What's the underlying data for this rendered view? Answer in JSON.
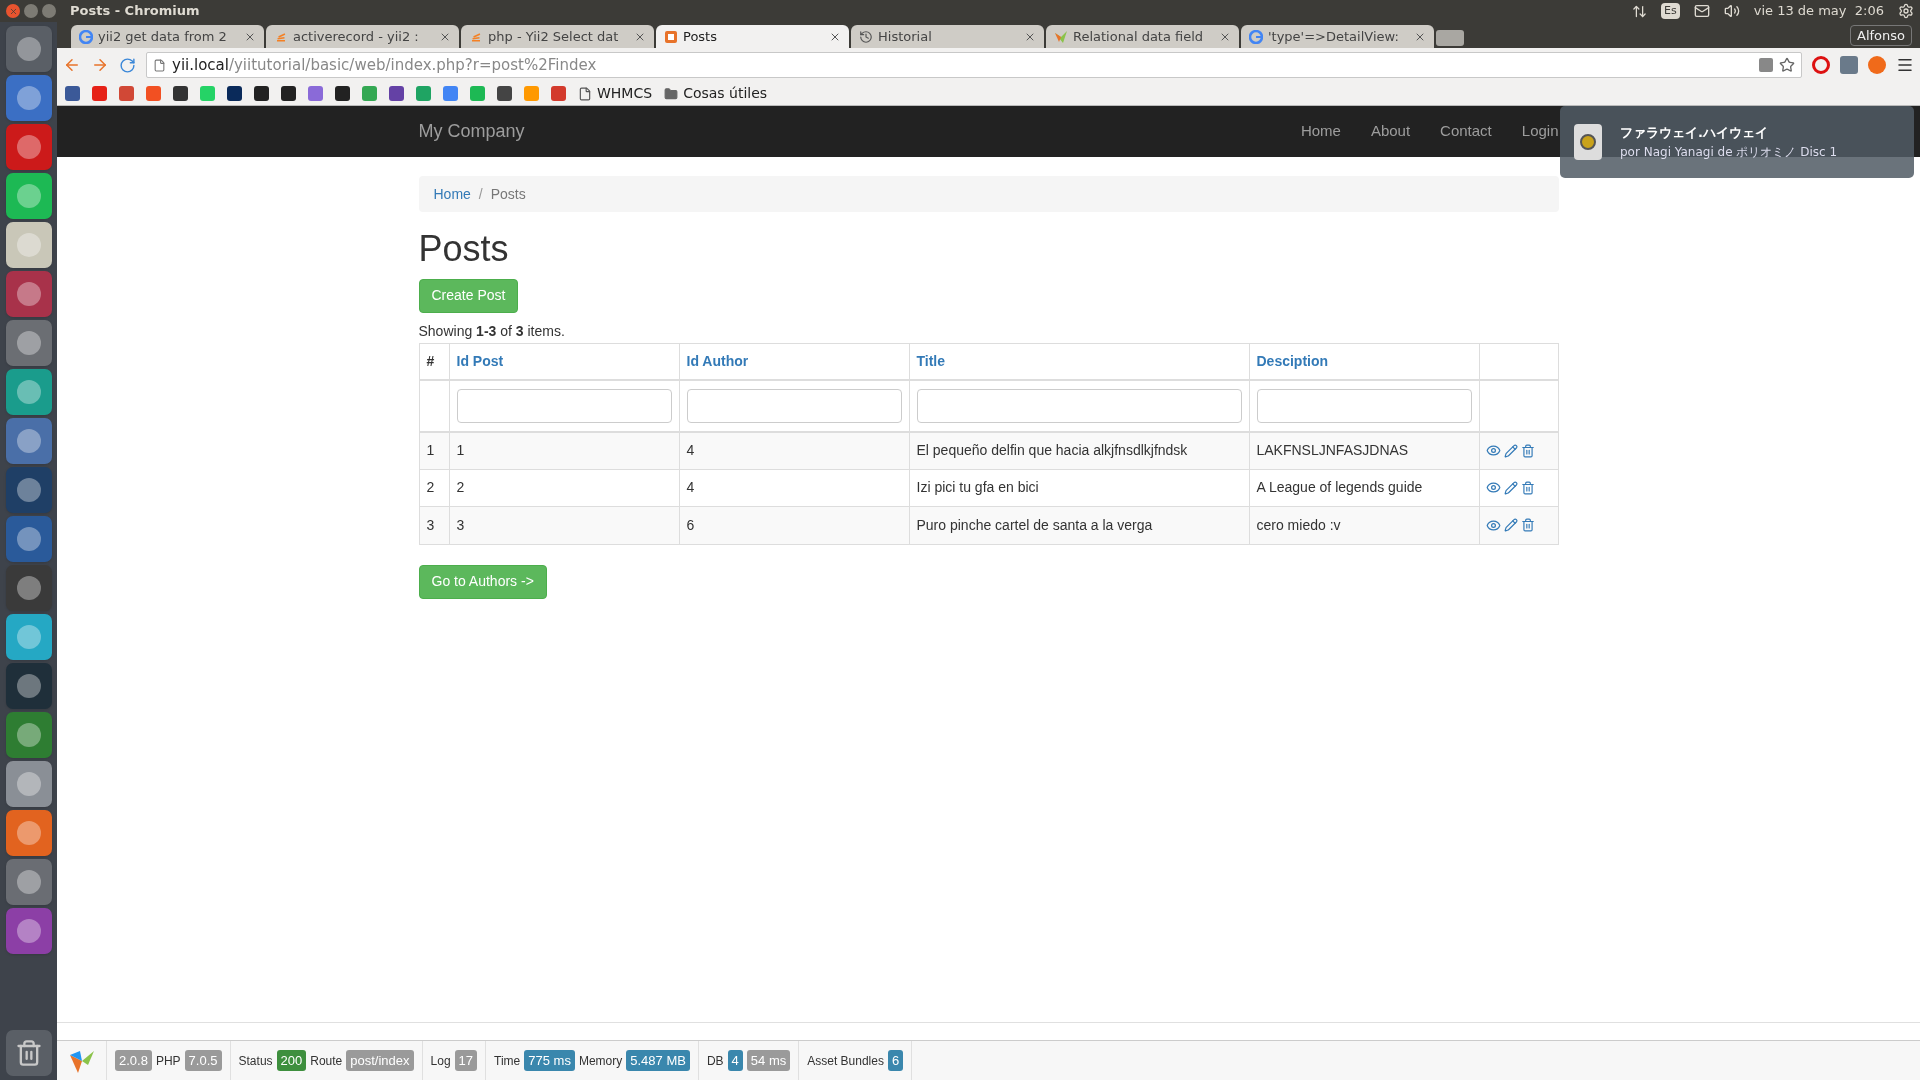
{
  "top_panel": {
    "window_title": "Posts - Chromium",
    "keyboard_layout": "Es",
    "clock": "vie 13 de may  2:06",
    "user": "Alfonso"
  },
  "tabs": [
    {
      "title": "yii2 get data from 2",
      "kind": "google",
      "selected": false
    },
    {
      "title": "activerecord - yii2 :",
      "kind": "stack",
      "selected": false
    },
    {
      "title": "php - Yii2 Select dat",
      "kind": "stack",
      "selected": false
    },
    {
      "title": "Posts",
      "kind": "yii",
      "selected": true
    },
    {
      "title": "Historial",
      "kind": "history",
      "selected": false
    },
    {
      "title": "Relational data field",
      "kind": "yiilogo",
      "selected": false
    },
    {
      "title": "'type'=>DetailView:",
      "kind": "google",
      "selected": false
    }
  ],
  "address_bar": {
    "host": "yii.local",
    "path": "/yiitutorial/basic/web/index.php?r=post%2Findex"
  },
  "bookmarks": [
    {
      "label": "WHMCS",
      "kind": "page"
    },
    {
      "label": "Cosas útiles",
      "kind": "folder"
    }
  ],
  "navbar": {
    "brand": "My Company",
    "links": [
      "Home",
      "About",
      "Contact",
      "Login"
    ]
  },
  "breadcrumb": {
    "separator": "/",
    "items": [
      {
        "label": "Home",
        "link": true
      },
      {
        "label": "Posts",
        "link": false
      }
    ]
  },
  "heading": "Posts",
  "create_button": "Create Post",
  "summary": "Showing **1-3** of **3** items.",
  "table": {
    "columns": [
      {
        "label": "#",
        "sortable": false,
        "filter": false
      },
      {
        "label": "Id Post",
        "sortable": true,
        "filter": true
      },
      {
        "label": "Id Author",
        "sortable": true,
        "filter": true
      },
      {
        "label": "Title",
        "sortable": true,
        "filter": true
      },
      {
        "label": "Desciption",
        "sortable": true,
        "filter": true
      }
    ],
    "rows": [
      [
        "1",
        "1",
        "4",
        "El pequeño delfin que hacia alkjfnsdlkjfndsk",
        "LAKFNSLJNFASJDNAS"
      ],
      [
        "2",
        "2",
        "4",
        "Izi pici tu gfa en bici",
        "A League of legends guide"
      ],
      [
        "3",
        "3",
        "6",
        "Puro pinche cartel de santa a la verga",
        "cero miedo :v"
      ]
    ]
  },
  "authors_button": "Go to Authors ->",
  "debug_toolbar": {
    "sections": [
      {
        "parts": [
          {
            "kind": "badge",
            "text": "2.0.8",
            "color": "#9a9a9a"
          },
          {
            "kind": "label",
            "text": "PHP"
          },
          {
            "kind": "badge",
            "text": "7.0.5",
            "color": "#9a9a9a"
          }
        ]
      },
      {
        "parts": [
          {
            "kind": "label",
            "text": "Status"
          },
          {
            "kind": "badge",
            "text": "200",
            "color": "#3e8f3e"
          },
          {
            "kind": "label",
            "text": "Route"
          },
          {
            "kind": "badge",
            "text": "post/index",
            "color": "#9a9a9a"
          }
        ]
      },
      {
        "parts": [
          {
            "kind": "label",
            "text": "Log"
          },
          {
            "kind": "badge",
            "text": "17",
            "color": "#9a9a9a"
          }
        ]
      },
      {
        "parts": [
          {
            "kind": "label",
            "text": "Time"
          },
          {
            "kind": "badge",
            "text": "775 ms",
            "color": "#3a87ad"
          },
          {
            "kind": "label",
            "text": "Memory"
          },
          {
            "kind": "badge",
            "text": "5.487 MB",
            "color": "#3a87ad"
          }
        ]
      },
      {
        "parts": [
          {
            "kind": "label",
            "text": "DB"
          },
          {
            "kind": "badge",
            "text": "4",
            "color": "#3a87ad"
          },
          {
            "kind": "badge",
            "text": "54 ms",
            "color": "#9a9a9a"
          }
        ]
      },
      {
        "parts": [
          {
            "kind": "label",
            "text": "Asset Bundles"
          },
          {
            "kind": "badge",
            "text": "6",
            "color": "#3a87ad"
          }
        ]
      }
    ]
  },
  "notification": {
    "title": "ファラウェイ.ハイウェイ",
    "subtitle": "por Nagi Yanagi de ポリオミノ Disc 1"
  }
}
